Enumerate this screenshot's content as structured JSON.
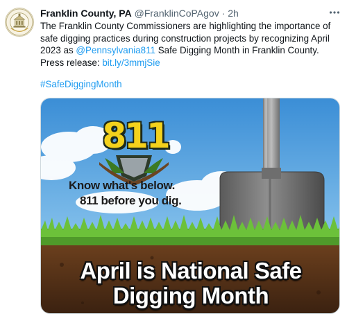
{
  "tweet": {
    "author_name": "Franklin County, PA",
    "author_handle": "@FranklinCoPAgov",
    "separator": "·",
    "time": "2h",
    "more_icon": "more-horizontal-icon",
    "text_part1": "The Franklin County Commissioners are highlighting the importance of safe digging practices during construction projects by recognizing April 2023 as ",
    "mention": "@Pennsylvania811",
    "text_part2": " Safe Digging Month in Franklin County. Press release: ",
    "link": "bit.ly/3mmjSie",
    "hashtag": "#SafeDiggingMonth",
    "avatar_text": "FRANKLIN COUNTY"
  },
  "media": {
    "logo_number": "811",
    "tagline_line1": "Know what's below.",
    "tagline_line2": "811 before you dig.",
    "headline_line1": "April is National Safe",
    "headline_line2": "Digging Month"
  },
  "colors": {
    "link": "#1d9bf0",
    "secondary_text": "#536471",
    "logo_yellow": "#f4d21c"
  }
}
